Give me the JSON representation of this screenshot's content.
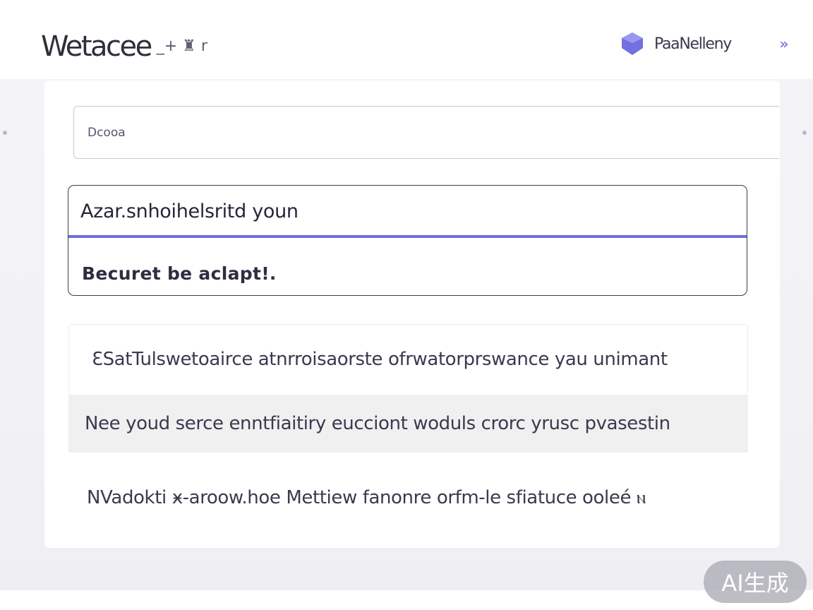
{
  "header": {
    "logo_text": "Wetacee",
    "logo_suffix": "_+ ♜ r",
    "user_name": "PaaNelleny",
    "expand_label": "»"
  },
  "search": {
    "placeholder": "Dcooa"
  },
  "question": {
    "input_value": "Azar.snhoihelsritd youn",
    "answer": "Becuret be aclapt!."
  },
  "results": [
    {
      "text": "ƐSatTulswetoairce atnrroisaorste ofrwatorprswance yau unimant"
    },
    {
      "text": "Nee youd serce enntfiaitiry eucciont woduls crorc yrusc pvasestin"
    },
    {
      "text": "NVadokti ӿ-aroow.hoe Mettiew fanonre orfm-le sfiatuce ooleé ⲛ"
    }
  ],
  "watermark": "AI生成",
  "colors": {
    "accent": "#6c6ce0",
    "avatar": "#7370e0",
    "selected_row_bg": "#f0f0f1",
    "page_bg": "#f3f3f7"
  },
  "icons": {
    "avatar": "hexagon-avatar-icon",
    "expand": "double-chevron-right-icon"
  }
}
